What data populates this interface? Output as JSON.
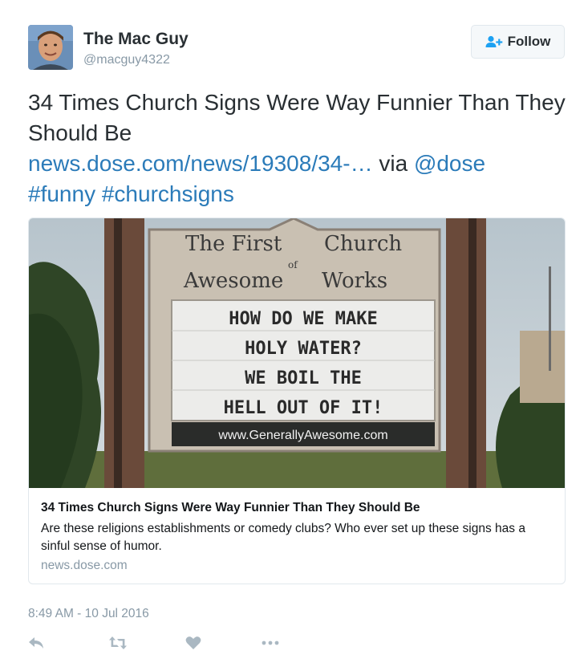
{
  "author": {
    "name": "The Mac Guy",
    "handle": "@macguy4322"
  },
  "follow_button": {
    "label": "Follow"
  },
  "tweet": {
    "text_main": "34 Times Church Signs Were Way Funnier Than They Should Be",
    "link_text": "news.dose.com/news/19308/34-…",
    "via_text": " via ",
    "mention": "@dose",
    "hashtags": [
      "#funny",
      "#churchsigns"
    ],
    "timestamp": "8:49 AM - 10 Jul 2016"
  },
  "card": {
    "image": {
      "sign_header_line1_left": "The First",
      "sign_header_line1_right": "Church",
      "sign_header_of": "of",
      "sign_header_line2_left": "Awesome",
      "sign_header_line2_right": "Works",
      "marquee_lines": [
        "HOW DO WE MAKE",
        "HOLY WATER?",
        "WE BOIL THE",
        "HELL OUT OF IT!"
      ],
      "website": "www.GenerallyAwesome.com"
    },
    "title": "34 Times Church Signs Were Way Funnier Than They Should Be",
    "description": "Are these religions establishments or comedy clubs? Who ever set up these signs has a sinful sense of humor.",
    "domain": "news.dose.com"
  },
  "icons": {
    "reply": "reply-icon",
    "retweet": "retweet-icon",
    "like": "heart-icon",
    "more": "more-icon",
    "follow": "add-user-icon"
  },
  "colors": {
    "link": "#2b7bb9",
    "secondary_text": "#8899a6",
    "action_icons": "#aab8c2"
  }
}
